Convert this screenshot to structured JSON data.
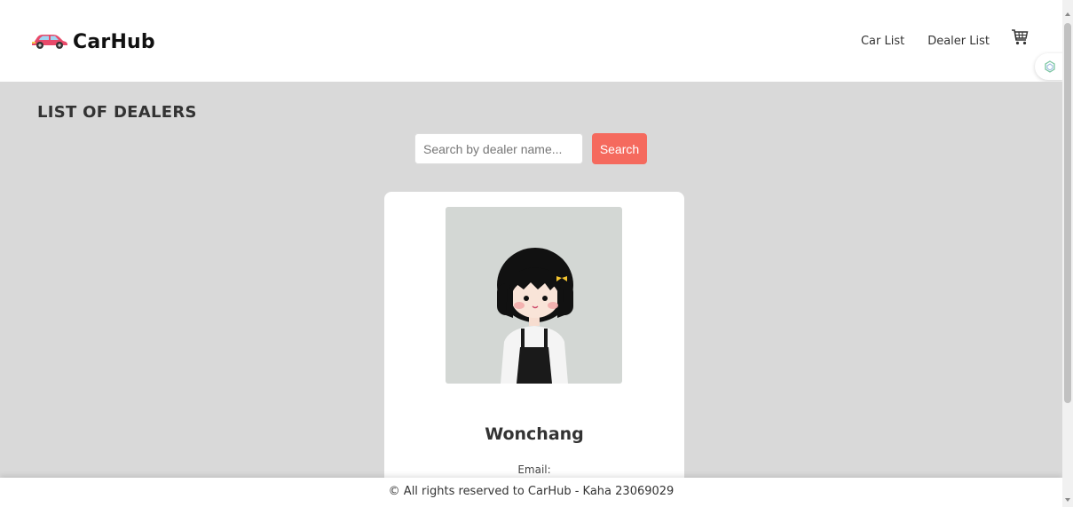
{
  "header": {
    "brand": "CarHub",
    "nav": [
      {
        "label": "Car List"
      },
      {
        "label": "Dealer List"
      }
    ]
  },
  "main": {
    "title": "LIST OF DEALERS",
    "search": {
      "placeholder": "Search by dealer name...",
      "value": "",
      "button_label": "Search"
    },
    "dealers": [
      {
        "name": "Wonchang",
        "email_label": "Email:"
      }
    ]
  },
  "footer": {
    "text": "© All rights reserved to CarHub - Kaha 23069029"
  },
  "colors": {
    "accent": "#f56a5e",
    "page_bg": "#d9d9d9"
  },
  "icons": [
    "car-logo-icon",
    "cart-icon",
    "extension-icon"
  ]
}
